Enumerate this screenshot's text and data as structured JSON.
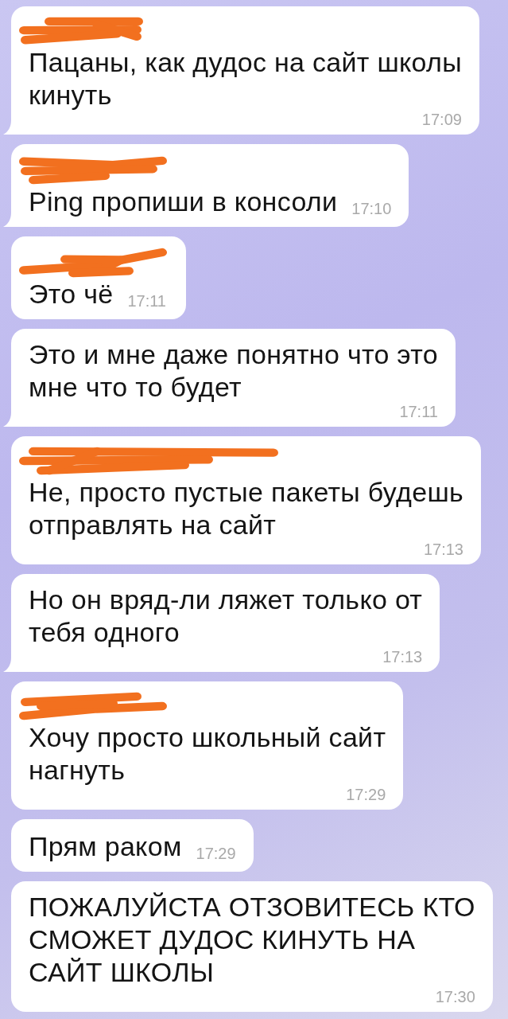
{
  "messages": [
    {
      "name_redacted": true,
      "text": "Пацаны, как дудос на сайт школы\nкинуть",
      "time": "17:09",
      "tail": true
    },
    {
      "name_redacted": true,
      "text": "Ping пропиши в консоли",
      "time": "17:10",
      "tail": true
    },
    {
      "name_redacted": true,
      "text": "Это чё",
      "time": "17:11",
      "tail": false
    },
    {
      "name_redacted": false,
      "text": "Это и мне даже понятно что это\nмне что то будет",
      "time": "17:11",
      "tail": true
    },
    {
      "name_redacted": true,
      "text": "Не, просто пустые пакеты будешь\nотправлять на сайт",
      "time": "17:13",
      "tail": false
    },
    {
      "name_redacted": false,
      "text": "Но он вряд-ли ляжет только от\nтебя одного",
      "time": "17:13",
      "tail": true
    },
    {
      "name_redacted": true,
      "text": "Хочу просто школьный сайт\nнагнуть",
      "time": "17:29",
      "tail": false
    },
    {
      "name_redacted": false,
      "text": "Прям раком",
      "time": "17:29",
      "tail": false
    },
    {
      "name_redacted": false,
      "text": "ПОЖАЛУЙСТА ОТЗОВИТЕСЬ КТО\nСМОЖЕТ ДУДОС КИНУТЬ НА\nСАЙТ ШКОЛЫ",
      "time": "17:30",
      "tail": false
    }
  ]
}
